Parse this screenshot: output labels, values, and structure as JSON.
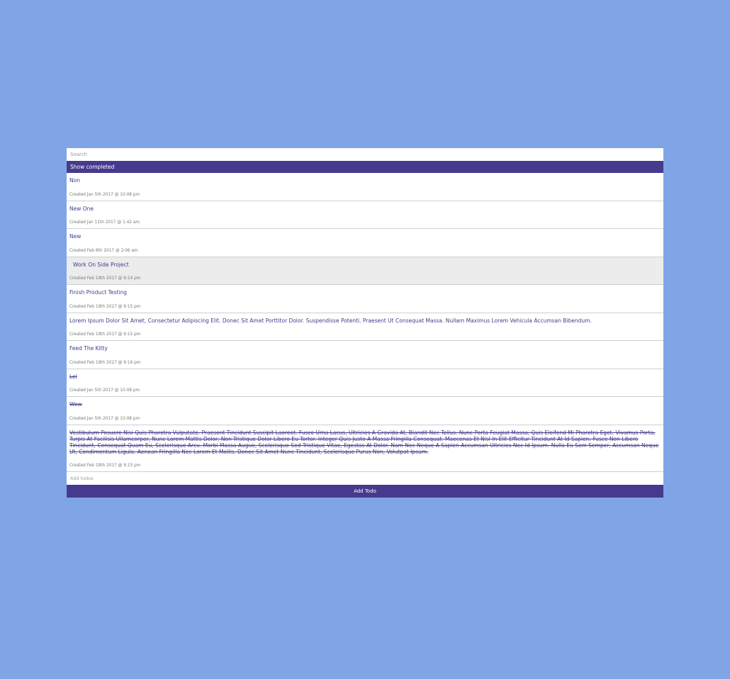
{
  "search": {
    "placeholder": "Search",
    "value": ""
  },
  "filter": {
    "show_completed_label": "Show completed"
  },
  "todos": [
    {
      "title": "Non",
      "meta": "Created Jan 5th 2017 @ 10:08 pm",
      "completed": false
    },
    {
      "title": "New One",
      "meta": "Created Jan 11th 2017 @ 1:42 am",
      "completed": false
    },
    {
      "title": "New",
      "meta": "Created Feb 8th 2017 @ 2:06 am",
      "completed": false
    },
    {
      "title": "Work On Side Project",
      "meta": "Created Feb 18th 2017 @ 9:14 pm",
      "completed": false
    },
    {
      "title": "Finish Product Testing",
      "meta": "Created Feb 18th 2017 @ 9:15 pm",
      "completed": false
    },
    {
      "title": "Lorem Ipsum Dolor Sit Amet, Consectetur Adipiscing Elit. Donec Sit Amet Porttitor Dolor. Suspendisse Potenti. Praesent Ut Consequat Massa. Nullam Maximus Lorem Vehicula Accumsan Bibendum.",
      "meta": "Created Feb 18th 2017 @ 9:15 pm",
      "completed": false
    },
    {
      "title": "Feed The Kitty",
      "meta": "Created Feb 18th 2017 @ 9:16 pm",
      "completed": false
    },
    {
      "title": "Lel",
      "meta": "Created Jan 5th 2017 @ 10:08 pm",
      "completed": true
    },
    {
      "title": "Wow",
      "meta": "Created Jan 5th 2017 @ 10:08 pm",
      "completed": true
    },
    {
      "title": "Vestibulum Posuere Nisi Quis Pharetra Vulputate. Praesent Tincidunt Suscipit Laoreet. Fusce Urna Lacus, Ultricies A Gravida At, Blandit Nec Tellus. Nunc Porta Feugiat Massa, Quis Eleifend Mi Pharetra Eget. Vivamus Porta, Turpis At Facilisis Ullamcorper, Nunc Lorem Mattis Dolor, Non Tristique Dolor Libero Eu Tortor. Integer Quis Justo A Massa Fringilla Consequat. Maecenas Et Nisl In Elit Efficitur Tincidunt At Id Sapien. Fusce Non Libero Tincidunt, Consequat Quam Eu, Scelerisque Arcu. Morbi Massa Augue, Scelerisque Sed Tristique Vitae, Egestas At Dolor. Nam Nec Neque A Sapien Accumsan Ultricies Nec Id Ipsum. Nulla Eu Sem Semper, Accumsan Neque Ut, Condimentum Ligula. Aenean Fringilla Nec Lorem Et Mollis. Donec Sit Amet Nunc Tincidunt, Scelerisque Purus Non, Volutpat Ipsum.",
      "meta": "Created Feb 18th 2017 @ 9:15 pm",
      "completed": true
    }
  ],
  "add": {
    "placeholder": "Add todos",
    "value": "",
    "button_label": "Add Todo"
  },
  "colors": {
    "background": "#7fa5e6",
    "accent": "#463a8e",
    "highlight_row": "#ececec"
  }
}
